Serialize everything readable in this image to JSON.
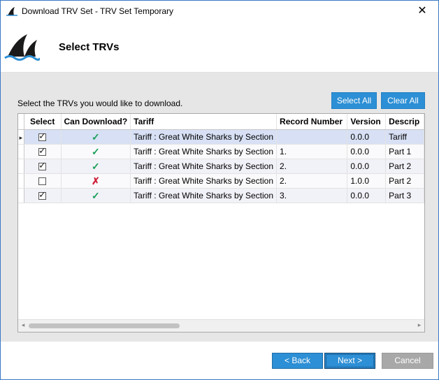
{
  "window": {
    "title": "Download TRV Set - TRV Set Temporary",
    "close_glyph": "✕"
  },
  "header": {
    "page_title": "Select TRVs",
    "logo_icon": "shark-fin-logo"
  },
  "content": {
    "instructions": "Select the TRVs you would like to download.",
    "select_all_label": "Select All",
    "clear_all_label": "Clear All"
  },
  "grid": {
    "columns": [
      "Select",
      "Can Download?",
      "Tariff",
      "Record Number",
      "Version",
      "Descrip"
    ],
    "rows": [
      {
        "select": true,
        "can_download": true,
        "tariff": "Tariff : Great White Sharks by Section",
        "record_number": "",
        "version": "0.0.0",
        "description": "Tariff"
      },
      {
        "select": true,
        "can_download": true,
        "tariff": "Tariff : Great White Sharks by Section",
        "record_number": "1.",
        "version": "0.0.0",
        "description": "Part 1"
      },
      {
        "select": true,
        "can_download": true,
        "tariff": "Tariff : Great White Sharks by Section",
        "record_number": "2.",
        "version": "0.0.0",
        "description": "Part 2"
      },
      {
        "select": false,
        "can_download": false,
        "tariff": "Tariff : Great White Sharks by Section",
        "record_number": "2.",
        "version": "1.0.0",
        "description": "Part 2"
      },
      {
        "select": true,
        "can_download": true,
        "tariff": "Tariff : Great White Sharks by Section",
        "record_number": "3.",
        "version": "0.0.0",
        "description": "Part 3"
      }
    ],
    "checked_glyph": "✓",
    "ok_glyph": "✓",
    "bad_glyph": "✗",
    "row_pointer_glyph": "▸",
    "scroll_left_glyph": "◂",
    "scroll_right_glyph": "▸",
    "colors": {
      "ok": "#1ca05a",
      "bad": "#d0213a",
      "selected_row": "#d7e0f4",
      "accent": "#2d8fd5"
    }
  },
  "footer": {
    "back_label": "< Back",
    "next_label": "Next >",
    "cancel_label": "Cancel"
  }
}
